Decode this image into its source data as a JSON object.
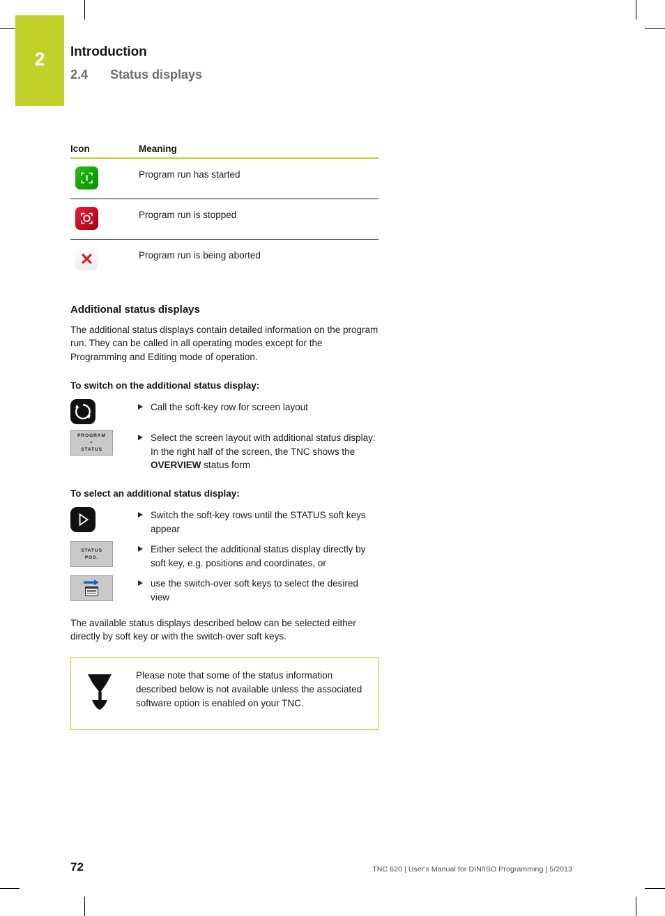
{
  "header": {
    "chapter_number": "2",
    "chapter_title": "Introduction",
    "section_number": "2.4",
    "section_title": "Status displays"
  },
  "icon_table": {
    "col_icon": "Icon",
    "col_meaning": "Meaning",
    "rows": [
      {
        "icon": "program-run-started-icon",
        "meaning": "Program run has started"
      },
      {
        "icon": "program-run-stopped-icon",
        "meaning": "Program run is stopped"
      },
      {
        "icon": "program-run-aborted-icon",
        "meaning": "Program run is being aborted"
      }
    ]
  },
  "additional": {
    "heading": "Additional status displays",
    "intro": "The additional status displays contain detailed information on the program run. They can be called in all operating modes except for the Programming and Editing mode of operation."
  },
  "switch_on": {
    "heading": "To switch on the additional status display:",
    "steps": [
      {
        "key_type": "hardkey",
        "key_icon": "screen-layout-key-icon",
        "text": "Call the soft-key row for screen layout"
      },
      {
        "key_type": "softkey",
        "key_icon": "program-status-softkey",
        "key_lines": [
          "PROGRAM",
          "+",
          "STATUS"
        ],
        "text_before": "Select the screen layout with additional status display: In the right half of the screen, the TNC shows the ",
        "text_bold": "OVERVIEW",
        "text_after": " status form"
      }
    ]
  },
  "select_display": {
    "heading": "To select an additional status display:",
    "steps": [
      {
        "key_type": "hardkey",
        "key_icon": "softkey-row-right-key-icon",
        "text": "Switch the soft-key rows until the STATUS soft keys appear"
      },
      {
        "key_type": "softkey",
        "key_icon": "status-pos-softkey",
        "key_lines": [
          "STATUS",
          "POS."
        ],
        "text": "Either select the additional status display directly by soft key, e.g. positions and coordinates, or"
      },
      {
        "key_type": "softkey",
        "key_icon": "switch-over-softkey",
        "text": "use the switch-over soft keys to select the desired view"
      }
    ]
  },
  "closing_paragraph": "The available status displays described below can be selected either directly by soft key or with the switch-over soft keys.",
  "note": {
    "icon": "milling-cutter-icon",
    "text": "Please note that some of the status information described below is not available unless the associated software option is enabled on your TNC."
  },
  "footer": {
    "page_number": "72",
    "meta": "TNC 620 | User's Manual for DIN/ISO Programming | 5/2013"
  },
  "colors": {
    "brand_green": "#c3d02a",
    "status_green": "#12a604",
    "status_red": "#c40d22",
    "abort_red": "#e8192b",
    "arrow_blue": "#1b63c8"
  }
}
